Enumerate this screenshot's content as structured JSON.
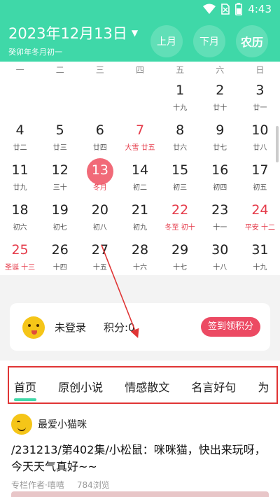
{
  "status_bar": {
    "time": "4:43"
  },
  "header": {
    "date_title": "2023年12月13日",
    "lunar_sub": "癸卯年冬月初一",
    "prev_month": "上月",
    "next_month": "下月",
    "lunar_calendar": "农历"
  },
  "weekdays": [
    "一",
    "二",
    "三",
    "四",
    "五",
    "六",
    "日"
  ],
  "calendar": [
    {
      "d": "",
      "l": ""
    },
    {
      "d": "",
      "l": ""
    },
    {
      "d": "",
      "l": ""
    },
    {
      "d": "",
      "l": ""
    },
    {
      "d": "1",
      "l": "十九"
    },
    {
      "d": "2",
      "l": "廿十"
    },
    {
      "d": "3",
      "l": "廿一"
    },
    {
      "d": "4",
      "l": "廿二"
    },
    {
      "d": "5",
      "l": "廿三"
    },
    {
      "d": "6",
      "l": "廿四"
    },
    {
      "d": "7",
      "l": "大雪 廿五",
      "red": true
    },
    {
      "d": "8",
      "l": "廿六"
    },
    {
      "d": "9",
      "l": "廿七"
    },
    {
      "d": "10",
      "l": "廿八"
    },
    {
      "d": "11",
      "l": "廿九"
    },
    {
      "d": "12",
      "l": "三十"
    },
    {
      "d": "13",
      "l": "冬月",
      "today": true
    },
    {
      "d": "14",
      "l": "初二"
    },
    {
      "d": "15",
      "l": "初三"
    },
    {
      "d": "16",
      "l": "初四"
    },
    {
      "d": "17",
      "l": "初五"
    },
    {
      "d": "18",
      "l": "初六"
    },
    {
      "d": "19",
      "l": "初七"
    },
    {
      "d": "20",
      "l": "初八"
    },
    {
      "d": "21",
      "l": "初九"
    },
    {
      "d": "22",
      "l": "冬至 初十",
      "red": true
    },
    {
      "d": "23",
      "l": "十一"
    },
    {
      "d": "24",
      "l": "平安 十二",
      "red": true
    },
    {
      "d": "25",
      "l": "圣诞 十三",
      "red": true
    },
    {
      "d": "26",
      "l": "十四"
    },
    {
      "d": "27",
      "l": "十五"
    },
    {
      "d": "28",
      "l": "十六"
    },
    {
      "d": "29",
      "l": "十七"
    },
    {
      "d": "30",
      "l": "十八"
    },
    {
      "d": "31",
      "l": "十九"
    }
  ],
  "score_card": {
    "login_status": "未登录",
    "points": "积分:0",
    "sign_button": "签到领积分"
  },
  "tabs": [
    "首页",
    "原创小说",
    "情感散文",
    "名言好句",
    "为"
  ],
  "post": {
    "author": "最爱小猫咪",
    "title": "/231213/第402集/小松鼠：咪咪猫，快出来玩呀，今天天气真好~~",
    "columnist": "专栏作者·嘻嘻",
    "views": "784浏览"
  },
  "colors": {
    "accent": "#3fd8a8",
    "festival_red": "#e53b4a",
    "today_circle": "#f16a78",
    "sign_button": "#ec4a63",
    "annotation": "#e03535"
  },
  "icons": [
    "wifi-icon",
    "sim-icon",
    "battery-icon",
    "caret-down-icon",
    "smiley-face-icon"
  ]
}
